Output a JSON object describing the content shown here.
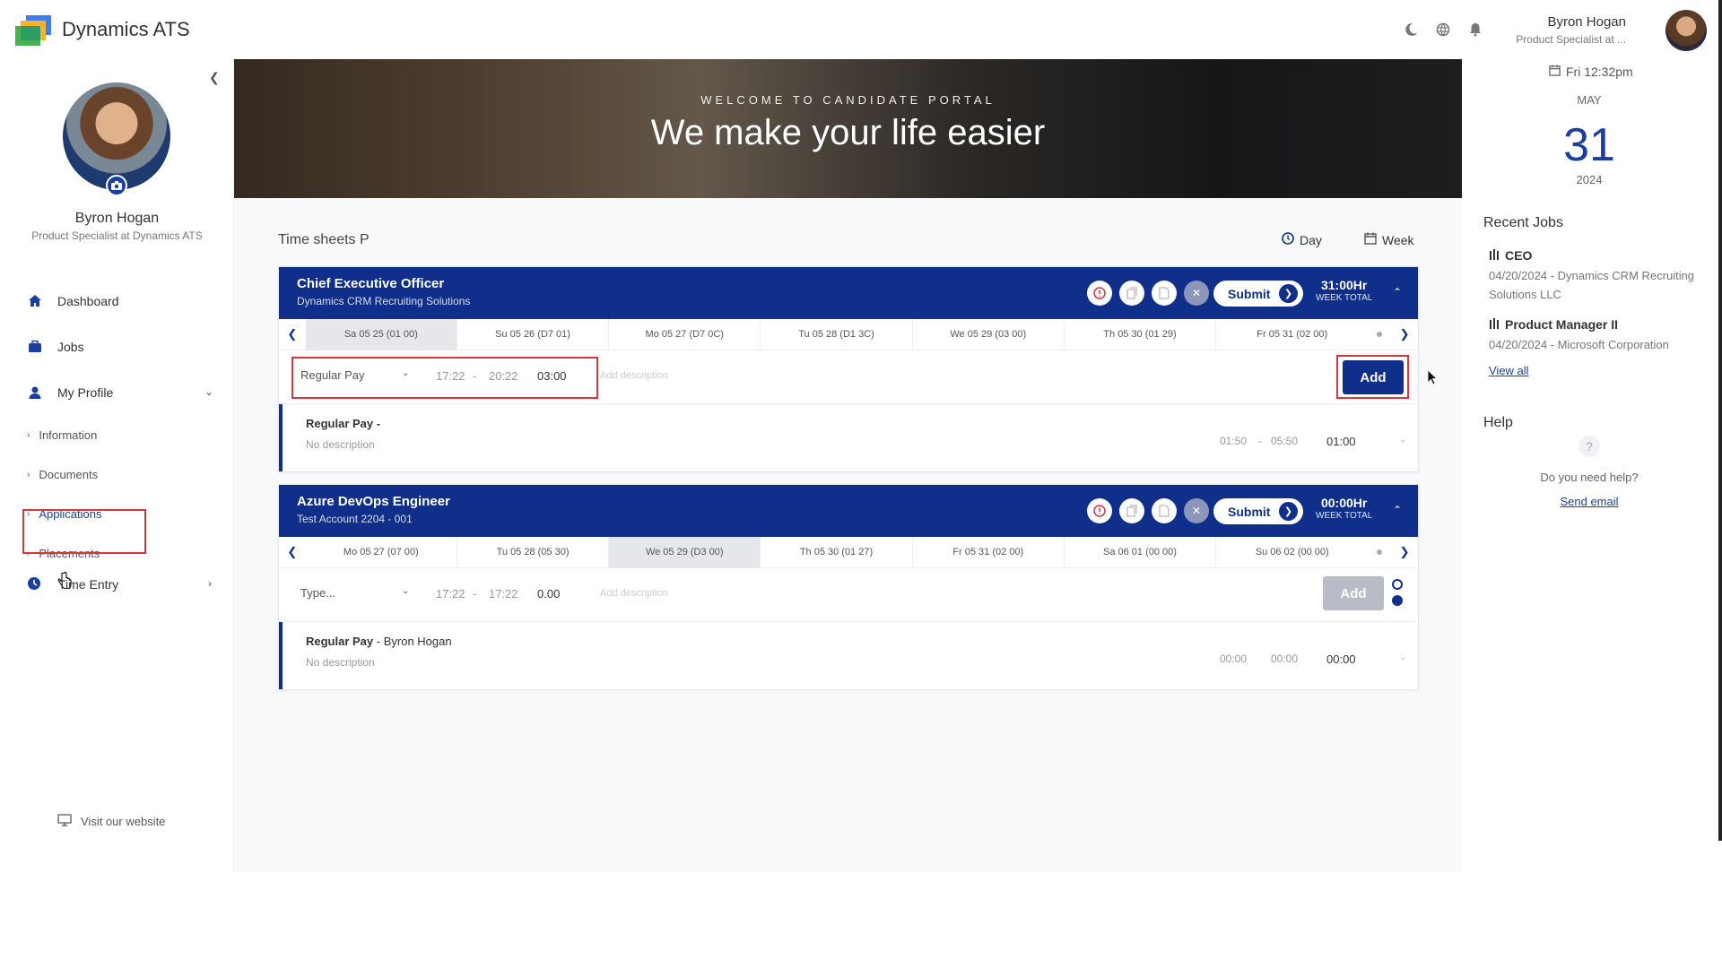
{
  "app": {
    "title": "Dynamics ATS"
  },
  "user": {
    "name": "Byron Hogan",
    "role_short": "Product Specialist at ...",
    "role_full": "Product Specialist at Dynamics ATS"
  },
  "sidebar": {
    "items": [
      {
        "label": "Dashboard",
        "icon": "home-icon"
      },
      {
        "label": "Jobs",
        "icon": "briefcase-icon"
      },
      {
        "label": "My Profile",
        "icon": "person-icon"
      }
    ],
    "sub_items": [
      "Information",
      "Documents",
      "Applications",
      "Placements"
    ],
    "time_entry": "Time Entry",
    "visit": "Visit our website"
  },
  "banner": {
    "subtitle": "WELCOME TO CANDIDATE PORTAL",
    "title": "We make your life easier"
  },
  "timesheets": {
    "title": "Time sheets P",
    "view_day": "Day",
    "view_week": "Week",
    "cards": [
      {
        "title": "Chief Executive Officer",
        "subtitle": "Dynamics CRM Recruiting Solutions",
        "submit": "Submit",
        "hours": "31:00Hr",
        "hours_label": "WEEK TOTAL",
        "days": [
          "Sa 05 25 (01 00)",
          "Su 05 26 (D7 01)",
          "Mo 05 27 (D7 0C)",
          "Tu 05 28 (D1 3C)",
          "We 05 29 (03 00)",
          "Th 05 30 (01 29)",
          "Fr 05 31 (02 00)"
        ],
        "entry": {
          "type": "Regular Pay",
          "start": "17:22",
          "end": "20:22",
          "duration": "03:00",
          "desc_placeholder": "Add description",
          "add": "Add"
        },
        "log": {
          "title": "Regular Pay -",
          "who": "",
          "desc": "No description",
          "start": "01:50",
          "end": "05:50",
          "duration": "01:00"
        }
      },
      {
        "title": "Azure DevOps Engineer",
        "subtitle": "Test Account 2204 - 001",
        "submit": "Submit",
        "hours": "00:00Hr",
        "hours_label": "WEEK TOTAL",
        "days": [
          "Mo 05 27 (07 00)",
          "Tu 05 28 (05 30)",
          "We 05 29 (D3 00)",
          "Th 05 30 (01 27)",
          "Fr 05 31 (02 00)",
          "Sa 06 01 (00 00)",
          "Su 06 02 (00 00)"
        ],
        "entry": {
          "type": "Type...",
          "start": "17:22",
          "end": "17:22",
          "duration": "0.00",
          "desc_placeholder": "Add description",
          "add": "Add"
        },
        "log": {
          "title": "Regular Pay",
          "who": "- Byron Hogan",
          "desc": "No description",
          "start": "00:00",
          "end": "00:00",
          "duration": "00:00"
        }
      }
    ]
  },
  "right": {
    "date_line": "Fri 12:32pm",
    "month": "MAY",
    "day": "31",
    "year": "2024",
    "recent_title": "Recent Jobs",
    "jobs": [
      {
        "title": "CEO",
        "detail": "04/20/2024 - Dynamics CRM Recruiting Solutions LLC"
      },
      {
        "title": "Product Manager II",
        "detail": "04/20/2024 - Microsoft Corporation"
      }
    ],
    "view_all": "View all",
    "help_title": "Help",
    "help_text": "Do you need help?",
    "help_link": "Send email"
  },
  "colors": {
    "primary": "#0f2f8a",
    "accent": "#1a3f9f",
    "highlight": "#d9353f"
  }
}
